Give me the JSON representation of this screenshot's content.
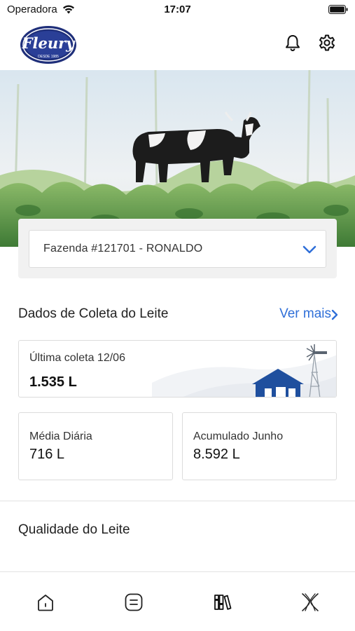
{
  "status_bar": {
    "carrier": "Operadora",
    "time": "17:07"
  },
  "header": {
    "logo_text": "Fleury",
    "logo_subtext": "DESDE 1985"
  },
  "farm_select": {
    "selected": "Fazenda #121701 - RONALDO"
  },
  "milk_collection": {
    "title": "Dados de Coleta do Leite",
    "see_more": "Ver mais",
    "last_collection": {
      "label": "Última coleta 12/06",
      "value": "1.535 L"
    },
    "daily_average": {
      "label": "Média Diária",
      "value": "716 L"
    },
    "accumulated": {
      "label": "Acumulado Junho",
      "value": "8.592 L"
    }
  },
  "milk_quality": {
    "title": "Qualidade do Leite"
  },
  "colors": {
    "accent": "#2f6fd8",
    "logo_navy": "#1f2f7a",
    "barn_blue": "#1f4f9e"
  },
  "tab_bar": {
    "items": [
      "home-icon",
      "list-icon",
      "library-icon",
      "x-logo-icon"
    ]
  }
}
